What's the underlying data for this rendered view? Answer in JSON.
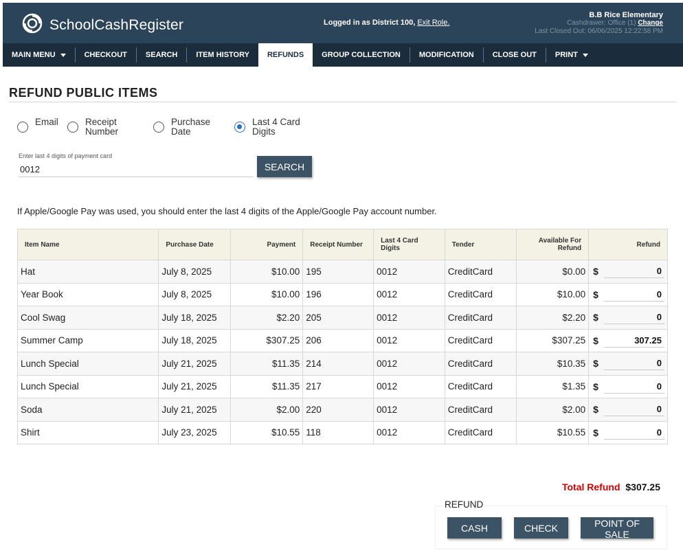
{
  "header": {
    "app_name": "SchoolCashRegister",
    "login_text": "Logged in as District 100,",
    "exit_role": "Exit Role.",
    "school_name": "B.B Rice Elementary",
    "cashdrawer": "Cashdrawer: Office (1)",
    "change_link": "Change",
    "last_closed": "Last Closed Out: 06/06/2025 12:22:58 PM"
  },
  "nav": {
    "items": [
      {
        "label": "MAIN MENU"
      },
      {
        "label": "CHECKOUT"
      },
      {
        "label": "SEARCH"
      },
      {
        "label": "ITEM HISTORY"
      },
      {
        "label": "REFUNDS"
      },
      {
        "label": "GROUP COLLECTION"
      },
      {
        "label": "MODIFICATION"
      },
      {
        "label": "CLOSE OUT"
      },
      {
        "label": "PRINT"
      }
    ],
    "active": "REFUNDS"
  },
  "page": {
    "title": "REFUND PUBLIC ITEMS",
    "radios": [
      {
        "label": "Email",
        "checked": false
      },
      {
        "label": "Receipt Number",
        "checked": false
      },
      {
        "label": "Purchase Date",
        "checked": false
      },
      {
        "label": "Last 4 Card Digits",
        "checked": true
      }
    ],
    "card_label": "Enter last 4 digits of payment card",
    "card_value": "0012",
    "search_button": "SEARCH",
    "note": "If Apple/Google Pay was used, you should enter the last 4 digits of the Apple/Google Pay account number."
  },
  "table": {
    "headers": [
      "Item Name",
      "Purchase Date",
      "Payment",
      "Receipt Number",
      "Last 4 Card Digits",
      "Tender",
      "Available For Refund",
      "Refund"
    ],
    "currency_symbol": "$",
    "rows": [
      {
        "item": "Hat",
        "date": "July 8, 2025",
        "payment": "$10.00",
        "receipt": "195",
        "last4": "0012",
        "tender": "CreditCard",
        "available": "$0.00",
        "refund": "0"
      },
      {
        "item": "Year Book",
        "date": "July 8, 2025",
        "payment": "$10.00",
        "receipt": "196",
        "last4": "0012",
        "tender": "CreditCard",
        "available": "$10.00",
        "refund": "0"
      },
      {
        "item": "Cool Swag",
        "date": "July 18, 2025",
        "payment": "$2.20",
        "receipt": "205",
        "last4": "0012",
        "tender": "CreditCard",
        "available": "$2.20",
        "refund": "0"
      },
      {
        "item": "Summer Camp",
        "date": "July 18, 2025",
        "payment": "$307.25",
        "receipt": "206",
        "last4": "0012",
        "tender": "CreditCard",
        "available": "$307.25",
        "refund": "307.25"
      },
      {
        "item": "Lunch Special",
        "date": "July 21, 2025",
        "payment": "$11.35",
        "receipt": "214",
        "last4": "0012",
        "tender": "CreditCard",
        "available": "$10.35",
        "refund": "0"
      },
      {
        "item": "Lunch Special",
        "date": "July 21, 2025",
        "payment": "$11.35",
        "receipt": "217",
        "last4": "0012",
        "tender": "CreditCard",
        "available": "$1.35",
        "refund": "0"
      },
      {
        "item": "Soda",
        "date": "July 21, 2025",
        "payment": "$2.00",
        "receipt": "220",
        "last4": "0012",
        "tender": "CreditCard",
        "available": "$2.00",
        "refund": "0"
      },
      {
        "item": "Shirt",
        "date": "July 23, 2025",
        "payment": "$10.55",
        "receipt": "118",
        "last4": "0012",
        "tender": "CreditCard",
        "available": "$10.55",
        "refund": "0"
      }
    ]
  },
  "total": {
    "label": "Total Refund",
    "amount": "$307.25"
  },
  "refund_actions": {
    "legend": "REFUND",
    "cash": "CASH",
    "check": "CHECK",
    "pos": "POINT OF SALE"
  },
  "colors": {
    "header_bg": "#2c4459",
    "nav_bg": "#1b2d3c",
    "button_bg": "#3c5366",
    "total_label": "#d00000",
    "radio_accent": "#2a6ec4"
  }
}
